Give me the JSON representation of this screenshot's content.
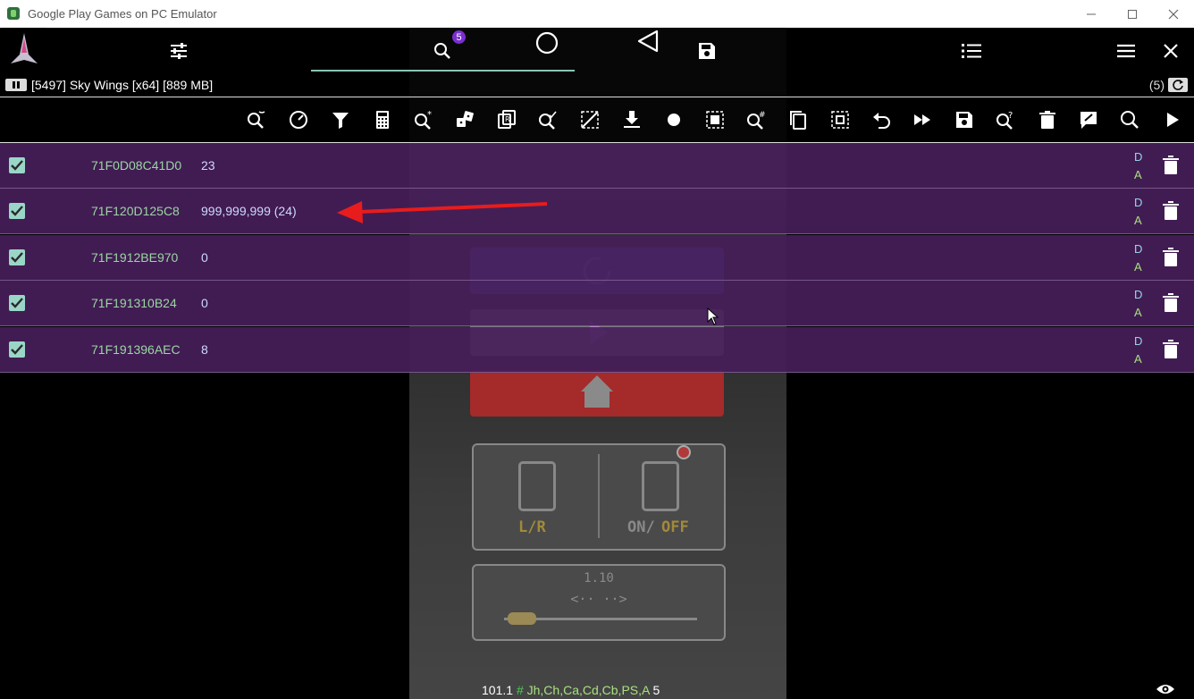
{
  "window": {
    "title": "Google Play Games on PC Emulator",
    "controls": [
      "minimize",
      "maximize",
      "close"
    ]
  },
  "header": {
    "search_badge": "5"
  },
  "status": {
    "process": "[5497] Sky Wings [x64] [889 MB]",
    "count": "(5)"
  },
  "toolbar_icons": [
    "search-fuzzy-icon",
    "speedhack-icon",
    "filter-icon",
    "calculator-icon",
    "search-star-icon",
    "random-icon",
    "copy-address-icon",
    "search-check-icon",
    "select-none-icon",
    "import-icon",
    "record-icon",
    "select-all-icon",
    "search-hash-icon",
    "copy-icon",
    "select-region-icon",
    "undo-icon",
    "fast-forward-icon",
    "save-icon",
    "search-question-icon",
    "delete-icon",
    "edit-icon",
    "search-icon",
    "run-icon"
  ],
  "results": [
    {
      "address": "71F0D08C41D0",
      "value": "23",
      "flag_d": "D",
      "flag_a": "A",
      "checked": true
    },
    {
      "address": "71F120D125C8",
      "value": "999,999,999 (24)",
      "flag_d": "D",
      "flag_a": "A",
      "checked": true
    },
    {
      "address": "71F1912BE970",
      "value": "0",
      "flag_d": "D",
      "flag_a": "A",
      "checked": true
    },
    {
      "address": "71F191310B24",
      "value": "0",
      "flag_d": "D",
      "flag_a": "A",
      "checked": true
    },
    {
      "address": "71F191396AEC",
      "value": "8",
      "flag_d": "D",
      "flag_a": "A",
      "checked": true
    }
  ],
  "game": {
    "label_lr": "L/R",
    "label_on": "ON/",
    "label_off": "OFF",
    "speed": "1.10",
    "arrows": "<·· ··>"
  },
  "bottom": {
    "version": "101.1",
    "hash": "#",
    "regions": "Jh,Ch,Ca,Cd,Cb,PS,A",
    "region_count": "5"
  },
  "colors": {
    "row_bg": "#46205a",
    "address": "#9bd6a2",
    "value": "#cfd9ff",
    "accent": "#8ac5b5",
    "arrow": "#e81c1c"
  }
}
